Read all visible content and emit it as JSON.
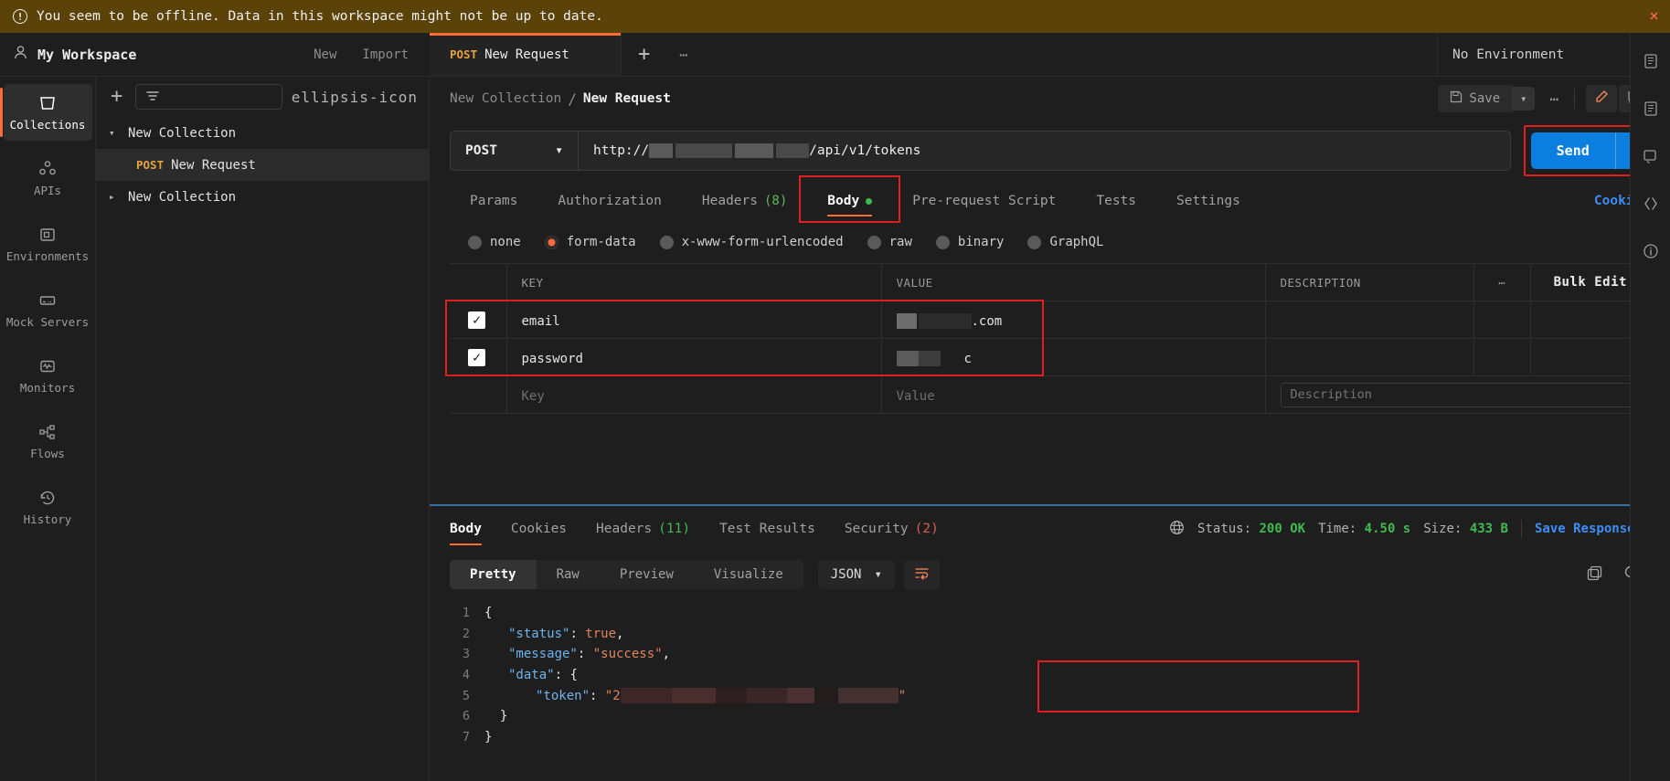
{
  "banner": {
    "message": "You seem to be offline. Data in this workspace might not be up to date.",
    "icon": "alert-circle-icon",
    "close": "×"
  },
  "workspace": {
    "title": "My Workspace",
    "new_label": "New",
    "import_label": "Import"
  },
  "rail": {
    "items": [
      {
        "label": "Collections",
        "icon": "collections-icon",
        "active": true
      },
      {
        "label": "APIs",
        "icon": "apis-icon",
        "active": false
      },
      {
        "label": "Environments",
        "icon": "environments-icon",
        "active": false
      },
      {
        "label": "Mock Servers",
        "icon": "mock-servers-icon",
        "active": false
      },
      {
        "label": "Monitors",
        "icon": "monitors-icon",
        "active": false
      },
      {
        "label": "Flows",
        "icon": "flows-icon",
        "active": false
      },
      {
        "label": "History",
        "icon": "history-icon",
        "active": false
      }
    ]
  },
  "sidebar": {
    "add_label": "+",
    "filter_icon": "filter-icon",
    "more_icon": "ellipsis-icon",
    "tree": [
      {
        "type": "collection",
        "label": "New Collection",
        "expanded": true
      },
      {
        "type": "request",
        "method": "POST",
        "label": "New Request",
        "selected": true
      },
      {
        "type": "collection",
        "label": "New Collection",
        "expanded": false
      }
    ]
  },
  "tabs": {
    "open": [
      {
        "method": "POST",
        "label": "New Request",
        "active": true
      }
    ],
    "add_label": "+",
    "more_label": "•••",
    "environment": "No Environment"
  },
  "breadcrumb": {
    "collection": "New Collection",
    "separator": "/",
    "request": "New Request",
    "save_label": "Save",
    "save_caret": "⌄",
    "more_label": "•••"
  },
  "request": {
    "method": "POST",
    "url_prefix": "http://",
    "url_suffix": "/api/v1/tokens",
    "url_redacted": true,
    "send_label": "Send",
    "send_caret": "⌄",
    "cookies_label": "Cookies",
    "tabs": [
      {
        "label": "Params",
        "active": false
      },
      {
        "label": "Authorization",
        "active": false
      },
      {
        "label": "Headers",
        "count": "(8)",
        "active": false
      },
      {
        "label": "Body",
        "active": true,
        "dot": true,
        "highlighted": true
      },
      {
        "label": "Pre-request Script",
        "active": false
      },
      {
        "label": "Tests",
        "active": false
      },
      {
        "label": "Settings",
        "active": false
      }
    ],
    "body_types": [
      {
        "label": "none",
        "selected": false
      },
      {
        "label": "form-data",
        "selected": true
      },
      {
        "label": "x-www-form-urlencoded",
        "selected": false
      },
      {
        "label": "raw",
        "selected": false
      },
      {
        "label": "binary",
        "selected": false
      },
      {
        "label": "GraphQL",
        "selected": false
      }
    ],
    "table": {
      "headers": [
        "KEY",
        "VALUE",
        "DESCRIPTION"
      ],
      "bulk_edit_label": "Bulk Edit",
      "more_label": "•••",
      "rows": [
        {
          "checked": true,
          "key": "email",
          "value_suffix": ".com",
          "value_redacted": true,
          "description": ""
        },
        {
          "checked": true,
          "key": "password",
          "value_suffix": "c",
          "value_redacted": true,
          "description": ""
        }
      ],
      "placeholder_row": {
        "key": "Key",
        "value": "Value",
        "description": "Description"
      },
      "highlighted": true
    }
  },
  "response": {
    "tabs": [
      {
        "label": "Body",
        "active": true
      },
      {
        "label": "Cookies",
        "active": false
      },
      {
        "label": "Headers",
        "count": "(11)",
        "count_color": "green",
        "active": false
      },
      {
        "label": "Test Results",
        "active": false
      },
      {
        "label": "Security",
        "count": "(2)",
        "count_color": "red",
        "active": false
      }
    ],
    "status": {
      "globe_icon": "globe-icon",
      "status_label": "Status:",
      "status_value": "200 OK",
      "time_label": "Time:",
      "time_value": "4.50 s",
      "size_label": "Size:",
      "size_value": "433 B",
      "save_response_label": "Save Response",
      "save_response_caret": "⌄"
    },
    "viewer": {
      "segments": [
        {
          "label": "Pretty",
          "active": true
        },
        {
          "label": "Raw",
          "active": false
        },
        {
          "label": "Preview",
          "active": false
        },
        {
          "label": "Visualize",
          "active": false
        }
      ],
      "format": "JSON",
      "format_caret": "⌄",
      "wrap_icon": "word-wrap-icon",
      "copy_icon": "copy-icon",
      "search_icon": "search-icon"
    },
    "code": {
      "language": "json",
      "token_highlighted": true,
      "lines": [
        {
          "n": "1",
          "text": "{"
        },
        {
          "n": "2",
          "key": "\"status\"",
          "sep": ": ",
          "value": "true",
          "value_type": "literal",
          "tail": ","
        },
        {
          "n": "3",
          "key": "\"message\"",
          "sep": ": ",
          "value": "\"success\"",
          "value_type": "string",
          "tail": ","
        },
        {
          "n": "4",
          "key": "\"data\"",
          "sep": ": ",
          "value": "{",
          "value_type": "punct",
          "tail": ""
        },
        {
          "n": "5",
          "key": "\"token\"",
          "sep": ": ",
          "value": "\"2",
          "value_type": "string-redacted",
          "tail": "\""
        },
        {
          "n": "6",
          "text": "  }"
        },
        {
          "n": "7",
          "text": "}"
        }
      ]
    }
  },
  "colors": {
    "accent_orange": "#ff6c37",
    "send_blue": "#0b7fe0",
    "link_blue": "#3d8ef7",
    "status_green": "#3fb950",
    "highlight_red": "#e02020",
    "banner_bg": "#5a4208",
    "method_post": "#e5a33c"
  }
}
